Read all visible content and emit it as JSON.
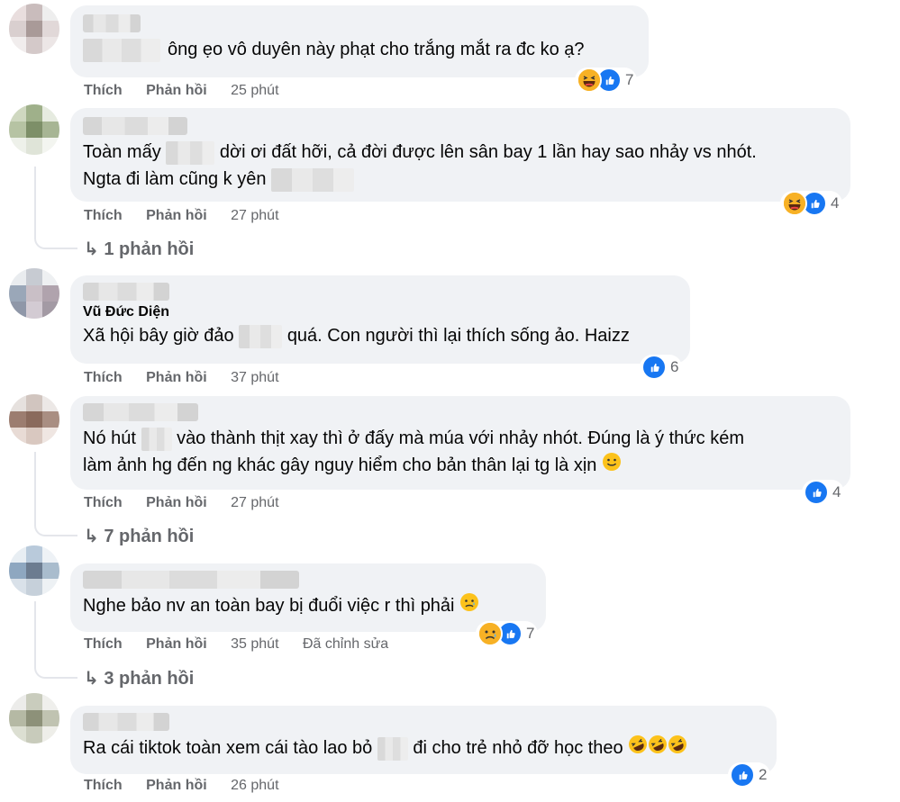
{
  "action_like": "Thích",
  "action_reply": "Phản hồi",
  "comments": [
    {
      "author": "",
      "text_line1": "ông ẹo vô duyên này phạt cho trắng mắt ra đc ko ạ?",
      "time": "25 phút",
      "reactions": [
        "haha",
        "like"
      ],
      "reaction_count": "7",
      "reply_count_label": ""
    },
    {
      "author": "",
      "text_line1a": "Toàn mấy",
      "text_line1b": "dời ơi đất hỡi, cả đời được lên sân bay 1 lần hay sao nhảy vs nhót.",
      "text_line2": "Ngta đi làm cũng k yên",
      "time": "27 phút",
      "reactions": [
        "haha",
        "like"
      ],
      "reaction_count": "4",
      "reply_count_label": "1 phản hồi"
    },
    {
      "author": "Vũ Đức Diện",
      "text_line1a": "Xã hội bây giờ đảo",
      "text_line1b": "quá. Con người thì lại thích sống ảo. Haizz",
      "time": "37 phút",
      "reactions": [
        "like"
      ],
      "reaction_count": "6",
      "reply_count_label": ""
    },
    {
      "author": "",
      "text_line1a": "Nó hút",
      "text_line1b": "vào thành thịt xay thì ở đấy mà múa với nhảy nhót. Đúng là ý thức kém",
      "text_line2": "làm ảnh hg đến ng khác gây nguy hiểm cho bản thân lại tg là xịn",
      "time": "27 phút",
      "reactions": [
        "like"
      ],
      "reaction_count": "4",
      "reply_count_label": "7 phản hồi"
    },
    {
      "author": "",
      "text_line1": "Nghe bảo nv an toàn bay bị đuổi việc r thì phải",
      "time": "35 phút",
      "edited": "Đã chỉnh sửa",
      "reactions": [
        "sad",
        "like"
      ],
      "reaction_count": "7",
      "reply_count_label": "3 phản hồi"
    },
    {
      "author": "",
      "text_line1a": "Ra cái tiktok toàn xem cái tào lao bỏ",
      "text_line1b": "đi cho trẻ nhỏ đỡ học theo",
      "time": "26 phút",
      "reactions": [
        "like"
      ],
      "reaction_count": "2",
      "reply_count_label": ""
    }
  ],
  "colors": {
    "bubble": "#f0f2f5",
    "meta_text": "#65676b",
    "like_blue": "#1877f2",
    "emoji_yellow": "#f7b125"
  }
}
